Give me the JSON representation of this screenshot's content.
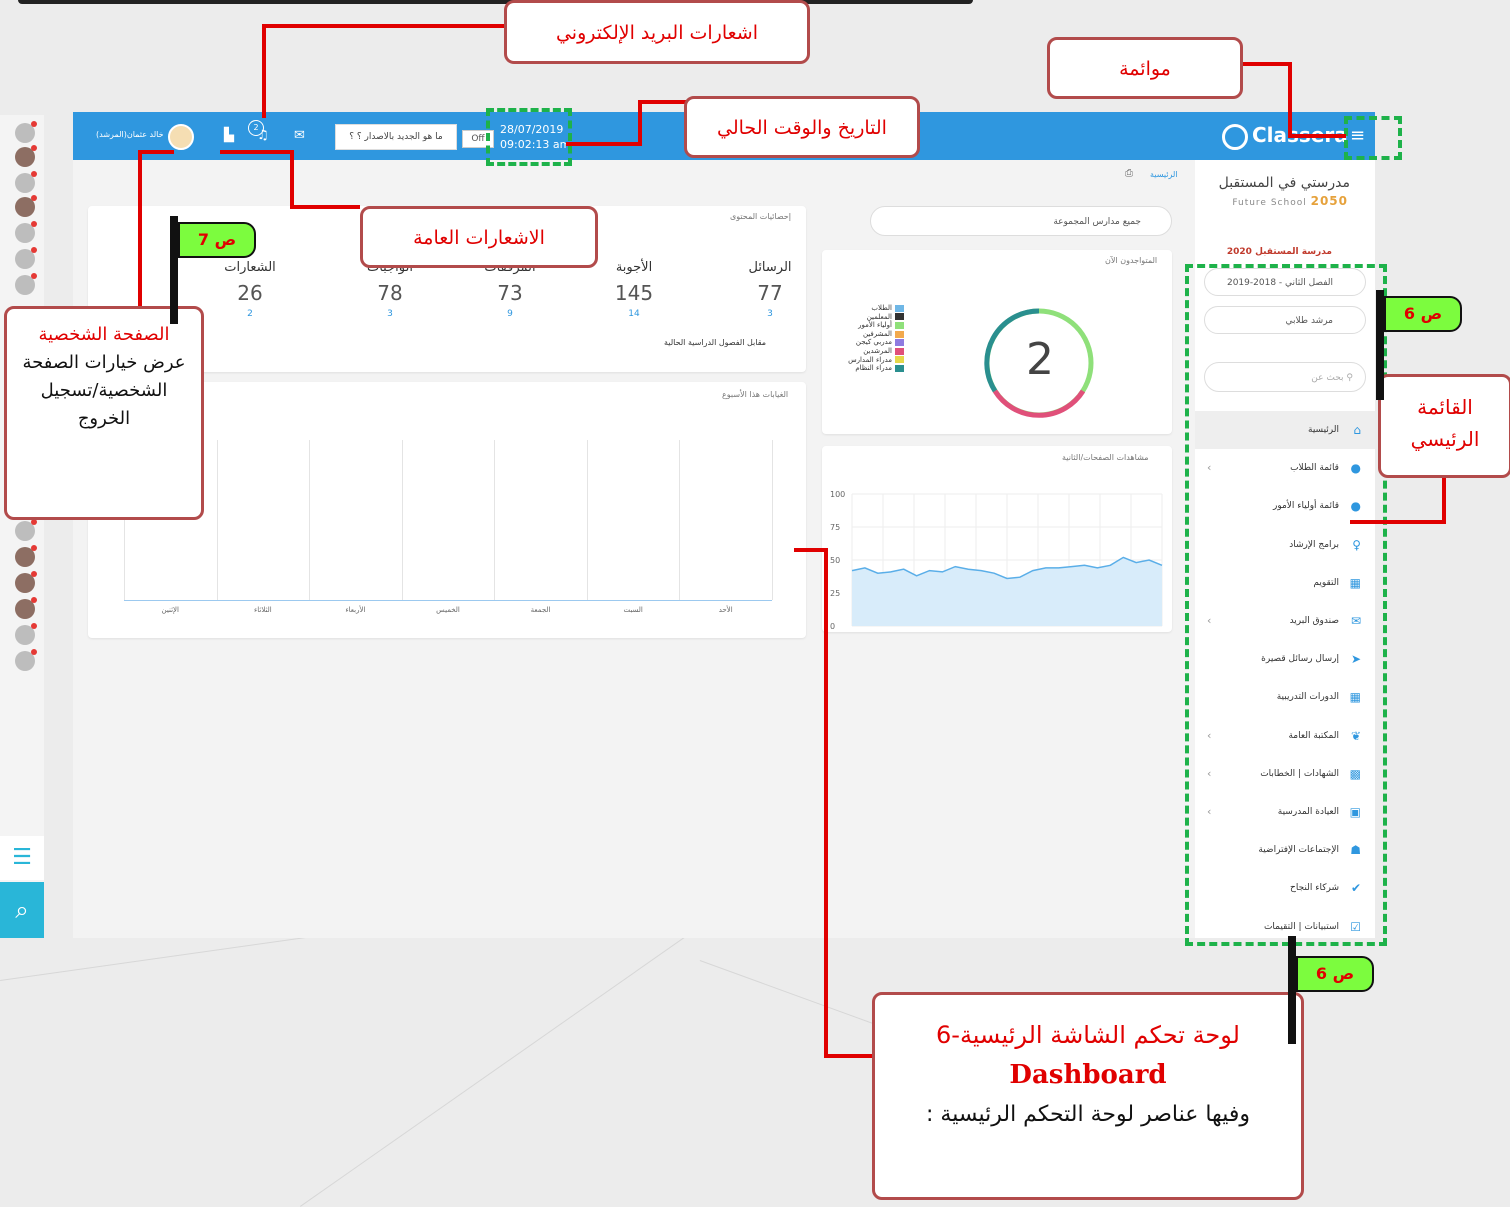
{
  "annotations": {
    "email_notifications": "اشعارات البريد الإلكتروني",
    "compatibility": "موائمة",
    "current_datetime": "التاريخ والوقت الحالي",
    "general_notifications": "الاشعارات العامة",
    "profile_title": "الصفحة الشخصية",
    "profile_body": "عرض خيارات الصفحة الشخصية/تسجيل الخروج",
    "main_menu": "القائمة الرئيسي",
    "dashboard_title": "6-لوحة تحكم الشاشة الرئيسية",
    "dashboard_en": "Dashboard",
    "dashboard_body": ": وفيها عناصر لوحة التحكم الرئيسية",
    "flag_page7": "ص 7",
    "flag_page6_a": "ص 6",
    "flag_page6_b": "ص 6"
  },
  "header": {
    "logo": "Classera",
    "date": "28/07/2019",
    "time": "09:02:13 am",
    "switch": "Off",
    "whats_new": "ما هو الجديد بالاصدار ؟ ؟",
    "notif_count": "2",
    "user_name": "خالد عثمان(المرشد)"
  },
  "sidebar": {
    "school_name": "مدرستي في المستقبل",
    "school_sub": "Future School",
    "school_year": "2050",
    "school_2020": "مدرسة المستقبل 2020",
    "semester": "الفصل الثاني - 2018-2019",
    "role": "مرشد طلابي",
    "search_placeholder": "بحث عن",
    "items": [
      {
        "label": "الرئيسية",
        "icon": "⌂",
        "chev": ""
      },
      {
        "label": "قائمة الطلاب",
        "icon": "●",
        "chev": "‹"
      },
      {
        "label": "قائمة أولياء الأمور",
        "icon": "●",
        "chev": ""
      },
      {
        "label": "برامج الإرشاد",
        "icon": "♀",
        "chev": ""
      },
      {
        "label": "التقويم",
        "icon": "▦",
        "chev": ""
      },
      {
        "label": "صندوق البريد",
        "icon": "✉",
        "chev": "‹"
      },
      {
        "label": "إرسال رسائل قصيرة",
        "icon": "➤",
        "chev": ""
      },
      {
        "label": "الدورات التدريبية",
        "icon": "▦",
        "chev": ""
      },
      {
        "label": "المكتبة العامة",
        "icon": "❦",
        "chev": "‹"
      },
      {
        "label": "الشهادات | الخطابات",
        "icon": "▩",
        "chev": "‹"
      },
      {
        "label": "العيادة المدرسية",
        "icon": "▣",
        "chev": "‹"
      },
      {
        "label": "الإجتماعات الإفتراضية",
        "icon": "☗",
        "chev": ""
      },
      {
        "label": "شركاء النجاح",
        "icon": "✔",
        "chev": ""
      },
      {
        "label": "استبيانات | التقيمات",
        "icon": "☑",
        "chev": ""
      }
    ]
  },
  "content": {
    "breadcrumb": "الرئيسية",
    "school_select": "جميع مدارس المجموعة",
    "stats_title": "إحصائيات المحتوى",
    "stats": [
      {
        "title": "الرسائل",
        "value": "77",
        "sub": "3"
      },
      {
        "title": "الأجوبة",
        "value": "145",
        "sub": "14"
      },
      {
        "title": "المرفقات",
        "value": "73",
        "sub": "9"
      },
      {
        "title": "الواجبات",
        "value": "78",
        "sub": "3"
      },
      {
        "title": "الشعارات",
        "value": "26",
        "sub": "2"
      }
    ],
    "stats_note": "مقابل الفصول الدراسية الحالية",
    "online_title": "المتواجدون الآن",
    "online_count": "2",
    "legend": [
      {
        "label": "الطلاب",
        "color": "#6fb7e6"
      },
      {
        "label": "المعلمين",
        "color": "#333333"
      },
      {
        "label": "أولياء الأمور",
        "color": "#8fe07a"
      },
      {
        "label": "المشرفين",
        "color": "#f2a94d"
      },
      {
        "label": "مدربي كيجن",
        "color": "#8f7be0"
      },
      {
        "label": "المرشدين",
        "color": "#e0507a"
      },
      {
        "label": "مدراء المدارس",
        "color": "#e6d84a"
      },
      {
        "label": "مدراء النظام",
        "color": "#2a8f8f"
      }
    ],
    "absence_title": "الغيابات هذا الأسبوع",
    "days": [
      "الأحد",
      "السبت",
      "الجمعة",
      "الخميس",
      "الأربعاء",
      "الثلاثاء",
      "الإثنين"
    ],
    "views_title": "مشاهدات الصفحات/الثانية",
    "views_y": [
      "100",
      "75",
      "50",
      "25",
      "0"
    ]
  },
  "chart_data": {
    "type": "area",
    "title": "مشاهدات الصفحات/الثانية",
    "ylim": [
      0,
      100
    ],
    "y_ticks": [
      0,
      25,
      50,
      75,
      100
    ],
    "values": [
      42,
      44,
      40,
      41,
      43,
      38,
      42,
      41,
      45,
      43,
      42,
      40,
      36,
      37,
      42,
      44,
      44,
      45,
      46,
      44,
      46,
      52,
      48,
      50,
      46
    ]
  },
  "colors": {
    "header": "#2f97df",
    "accent": "#29b6d8",
    "annotation_red": "#e00000",
    "dashed_green": "#1eb24a"
  }
}
